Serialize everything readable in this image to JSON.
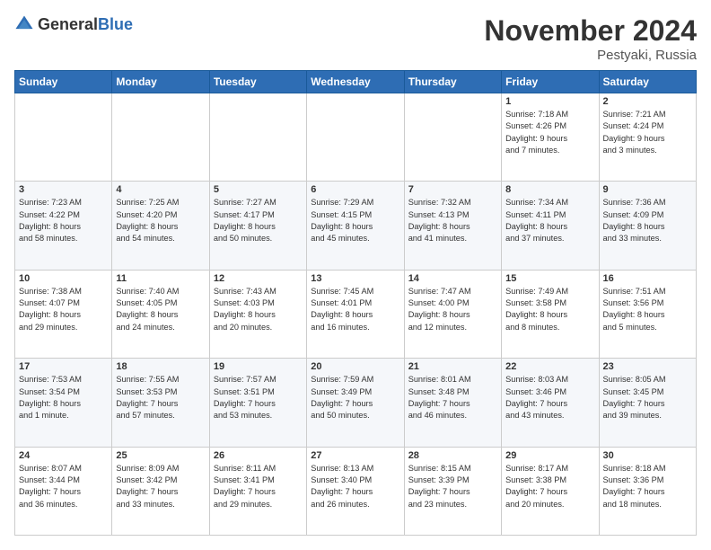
{
  "header": {
    "logo_general": "General",
    "logo_blue": "Blue",
    "month_title": "November 2024",
    "location": "Pestyaki, Russia"
  },
  "weekdays": [
    "Sunday",
    "Monday",
    "Tuesday",
    "Wednesday",
    "Thursday",
    "Friday",
    "Saturday"
  ],
  "weeks": [
    [
      {
        "day": "",
        "info": ""
      },
      {
        "day": "",
        "info": ""
      },
      {
        "day": "",
        "info": ""
      },
      {
        "day": "",
        "info": ""
      },
      {
        "day": "",
        "info": ""
      },
      {
        "day": "1",
        "info": "Sunrise: 7:18 AM\nSunset: 4:26 PM\nDaylight: 9 hours\nand 7 minutes."
      },
      {
        "day": "2",
        "info": "Sunrise: 7:21 AM\nSunset: 4:24 PM\nDaylight: 9 hours\nand 3 minutes."
      }
    ],
    [
      {
        "day": "3",
        "info": "Sunrise: 7:23 AM\nSunset: 4:22 PM\nDaylight: 8 hours\nand 58 minutes."
      },
      {
        "day": "4",
        "info": "Sunrise: 7:25 AM\nSunset: 4:20 PM\nDaylight: 8 hours\nand 54 minutes."
      },
      {
        "day": "5",
        "info": "Sunrise: 7:27 AM\nSunset: 4:17 PM\nDaylight: 8 hours\nand 50 minutes."
      },
      {
        "day": "6",
        "info": "Sunrise: 7:29 AM\nSunset: 4:15 PM\nDaylight: 8 hours\nand 45 minutes."
      },
      {
        "day": "7",
        "info": "Sunrise: 7:32 AM\nSunset: 4:13 PM\nDaylight: 8 hours\nand 41 minutes."
      },
      {
        "day": "8",
        "info": "Sunrise: 7:34 AM\nSunset: 4:11 PM\nDaylight: 8 hours\nand 37 minutes."
      },
      {
        "day": "9",
        "info": "Sunrise: 7:36 AM\nSunset: 4:09 PM\nDaylight: 8 hours\nand 33 minutes."
      }
    ],
    [
      {
        "day": "10",
        "info": "Sunrise: 7:38 AM\nSunset: 4:07 PM\nDaylight: 8 hours\nand 29 minutes."
      },
      {
        "day": "11",
        "info": "Sunrise: 7:40 AM\nSunset: 4:05 PM\nDaylight: 8 hours\nand 24 minutes."
      },
      {
        "day": "12",
        "info": "Sunrise: 7:43 AM\nSunset: 4:03 PM\nDaylight: 8 hours\nand 20 minutes."
      },
      {
        "day": "13",
        "info": "Sunrise: 7:45 AM\nSunset: 4:01 PM\nDaylight: 8 hours\nand 16 minutes."
      },
      {
        "day": "14",
        "info": "Sunrise: 7:47 AM\nSunset: 4:00 PM\nDaylight: 8 hours\nand 12 minutes."
      },
      {
        "day": "15",
        "info": "Sunrise: 7:49 AM\nSunset: 3:58 PM\nDaylight: 8 hours\nand 8 minutes."
      },
      {
        "day": "16",
        "info": "Sunrise: 7:51 AM\nSunset: 3:56 PM\nDaylight: 8 hours\nand 5 minutes."
      }
    ],
    [
      {
        "day": "17",
        "info": "Sunrise: 7:53 AM\nSunset: 3:54 PM\nDaylight: 8 hours\nand 1 minute."
      },
      {
        "day": "18",
        "info": "Sunrise: 7:55 AM\nSunset: 3:53 PM\nDaylight: 7 hours\nand 57 minutes."
      },
      {
        "day": "19",
        "info": "Sunrise: 7:57 AM\nSunset: 3:51 PM\nDaylight: 7 hours\nand 53 minutes."
      },
      {
        "day": "20",
        "info": "Sunrise: 7:59 AM\nSunset: 3:49 PM\nDaylight: 7 hours\nand 50 minutes."
      },
      {
        "day": "21",
        "info": "Sunrise: 8:01 AM\nSunset: 3:48 PM\nDaylight: 7 hours\nand 46 minutes."
      },
      {
        "day": "22",
        "info": "Sunrise: 8:03 AM\nSunset: 3:46 PM\nDaylight: 7 hours\nand 43 minutes."
      },
      {
        "day": "23",
        "info": "Sunrise: 8:05 AM\nSunset: 3:45 PM\nDaylight: 7 hours\nand 39 minutes."
      }
    ],
    [
      {
        "day": "24",
        "info": "Sunrise: 8:07 AM\nSunset: 3:44 PM\nDaylight: 7 hours\nand 36 minutes."
      },
      {
        "day": "25",
        "info": "Sunrise: 8:09 AM\nSunset: 3:42 PM\nDaylight: 7 hours\nand 33 minutes."
      },
      {
        "day": "26",
        "info": "Sunrise: 8:11 AM\nSunset: 3:41 PM\nDaylight: 7 hours\nand 29 minutes."
      },
      {
        "day": "27",
        "info": "Sunrise: 8:13 AM\nSunset: 3:40 PM\nDaylight: 7 hours\nand 26 minutes."
      },
      {
        "day": "28",
        "info": "Sunrise: 8:15 AM\nSunset: 3:39 PM\nDaylight: 7 hours\nand 23 minutes."
      },
      {
        "day": "29",
        "info": "Sunrise: 8:17 AM\nSunset: 3:38 PM\nDaylight: 7 hours\nand 20 minutes."
      },
      {
        "day": "30",
        "info": "Sunrise: 8:18 AM\nSunset: 3:36 PM\nDaylight: 7 hours\nand 18 minutes."
      }
    ]
  ]
}
